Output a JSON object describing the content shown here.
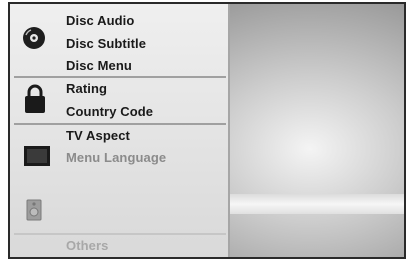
{
  "menu": {
    "disc_section": {
      "items": [
        "Disc Audio",
        "Disc Subtitle",
        "Disc Menu"
      ],
      "icon": "disc-icon"
    },
    "lock_section": {
      "items": [
        "Rating",
        "Country Code"
      ],
      "icon": "lock-icon"
    },
    "display_section": {
      "items": [
        "TV Aspect",
        "Menu Language"
      ],
      "icon": "tv-icon"
    },
    "audio_section": {
      "icon": "speaker-icon"
    },
    "others_label": "Others"
  }
}
